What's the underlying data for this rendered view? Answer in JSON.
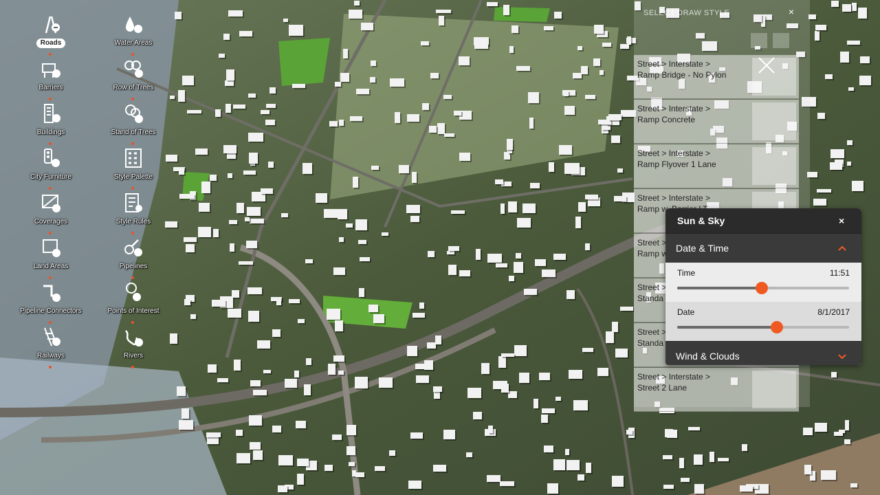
{
  "tools": [
    {
      "id": "roads",
      "label": "Roads",
      "icon": "roads-icon",
      "active": true
    },
    {
      "id": "water-areas",
      "label": "Water Areas",
      "icon": "water-areas-icon",
      "active": false
    },
    {
      "id": "barriers",
      "label": "Barriers",
      "icon": "barriers-icon",
      "active": false
    },
    {
      "id": "row-of-trees",
      "label": "Row of Trees",
      "icon": "row-of-trees-icon",
      "active": false
    },
    {
      "id": "buildings",
      "label": "Buildings",
      "icon": "buildings-icon",
      "active": false
    },
    {
      "id": "stand-of-trees",
      "label": "Stand of Trees",
      "icon": "stand-of-trees-icon",
      "active": false
    },
    {
      "id": "city-furniture",
      "label": "City Furniture",
      "icon": "city-furniture-icon",
      "active": false
    },
    {
      "id": "style-palette",
      "label": "Style Palette",
      "icon": "style-palette-icon",
      "active": false
    },
    {
      "id": "coverages",
      "label": "Coverages",
      "icon": "coverages-icon",
      "active": false
    },
    {
      "id": "style-rules",
      "label": "Style Rules",
      "icon": "style-rules-icon",
      "active": false
    },
    {
      "id": "land-areas",
      "label": "Land Areas",
      "icon": "land-areas-icon",
      "active": false
    },
    {
      "id": "pipelines",
      "label": "Pipelines",
      "icon": "pipelines-icon",
      "active": false
    },
    {
      "id": "pipeline-connectors",
      "label": "Pipeline Connectors",
      "icon": "pipeline-connectors-icon",
      "active": false
    },
    {
      "id": "points-of-interest",
      "label": "Points of Interest",
      "icon": "points-of-interest-icon",
      "active": false
    },
    {
      "id": "railways",
      "label": "Railways",
      "icon": "railways-icon",
      "active": false
    },
    {
      "id": "rivers",
      "label": "Rivers",
      "icon": "rivers-icon",
      "active": false
    }
  ],
  "draw_style": {
    "title": "SELECT DRAW STYLE",
    "close_label": "×",
    "items": [
      {
        "line1": "Street > Interstate >",
        "line2": "Ramp Bridge - No Pylon"
      },
      {
        "line1": "Street > Interstate >",
        "line2": "Ramp Concrete"
      },
      {
        "line1": "Street > Interstate >",
        "line2": "Ramp Flyover 1 Lane"
      },
      {
        "line1": "Street > Interstate >",
        "line2": "Ramp w. Barrier LT"
      },
      {
        "line1": "Street >",
        "line2": "Ramp w"
      },
      {
        "line1": "Street >",
        "line2": "Standa"
      },
      {
        "line1": "Street >",
        "line2": "Standa"
      },
      {
        "line1": "Street > Interstate >",
        "line2": "Street 2 Lane"
      }
    ]
  },
  "sun_sky": {
    "title": "Sun & Sky",
    "close_label": "×",
    "date_time_section": "Date & Time",
    "time_label": "Time",
    "time_value": "11:51",
    "time_fraction": 0.49,
    "date_label": "Date",
    "date_value": "8/1/2017",
    "date_fraction": 0.58,
    "wind_clouds_section": "Wind & Clouds",
    "accent_color": "#f05a22"
  }
}
